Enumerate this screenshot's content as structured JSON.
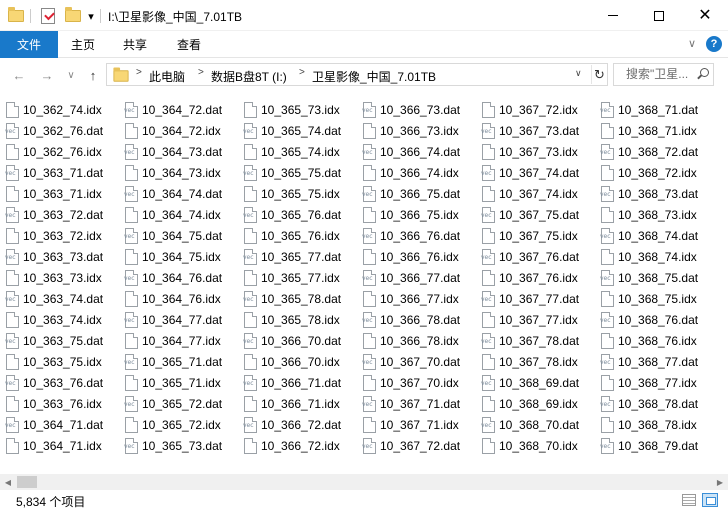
{
  "window": {
    "title": "I:\\卫星影像_中国_7.01TB",
    "dropdown_glyph": "▾",
    "min_label": "",
    "max_label": "",
    "close_label": "✕"
  },
  "ribbon": {
    "file_tab": "文件",
    "tabs": [
      "主页",
      "共享",
      "查看"
    ],
    "expand_glyph": "∨",
    "help_glyph": "?"
  },
  "nav": {
    "back": "←",
    "forward": "→",
    "recent": "∨",
    "up": "↑",
    "breadcrumb": [
      "此电脑",
      "数据B盘8T (I:)",
      "卫星影像_中国_7.01TB"
    ],
    "separator": ">",
    "address_dropdown": "∨",
    "refresh": "↻"
  },
  "search": {
    "placeholder": "搜索\"卫星..."
  },
  "files": {
    "columns": [
      [
        {
          "name": "10_362_74.idx",
          "type": "idx"
        },
        {
          "name": "10_362_76.dat",
          "type": "dat"
        },
        {
          "name": "10_362_76.idx",
          "type": "idx"
        },
        {
          "name": "10_363_71.dat",
          "type": "dat"
        },
        {
          "name": "10_363_71.idx",
          "type": "idx"
        },
        {
          "name": "10_363_72.dat",
          "type": "dat"
        },
        {
          "name": "10_363_72.idx",
          "type": "idx"
        },
        {
          "name": "10_363_73.dat",
          "type": "dat"
        },
        {
          "name": "10_363_73.idx",
          "type": "idx"
        },
        {
          "name": "10_363_74.dat",
          "type": "dat"
        },
        {
          "name": "10_363_74.idx",
          "type": "idx"
        },
        {
          "name": "10_363_75.dat",
          "type": "dat"
        },
        {
          "name": "10_363_75.idx",
          "type": "idx"
        },
        {
          "name": "10_363_76.dat",
          "type": "dat"
        },
        {
          "name": "10_363_76.idx",
          "type": "idx"
        },
        {
          "name": "10_364_71.dat",
          "type": "dat"
        },
        {
          "name": "10_364_71.idx",
          "type": "idx"
        }
      ],
      [
        {
          "name": "10_364_72.dat",
          "type": "dat"
        },
        {
          "name": "10_364_72.idx",
          "type": "idx"
        },
        {
          "name": "10_364_73.dat",
          "type": "dat"
        },
        {
          "name": "10_364_73.idx",
          "type": "idx"
        },
        {
          "name": "10_364_74.dat",
          "type": "dat"
        },
        {
          "name": "10_364_74.idx",
          "type": "idx"
        },
        {
          "name": "10_364_75.dat",
          "type": "dat"
        },
        {
          "name": "10_364_75.idx",
          "type": "idx"
        },
        {
          "name": "10_364_76.dat",
          "type": "dat"
        },
        {
          "name": "10_364_76.idx",
          "type": "idx"
        },
        {
          "name": "10_364_77.dat",
          "type": "dat"
        },
        {
          "name": "10_364_77.idx",
          "type": "idx"
        },
        {
          "name": "10_365_71.dat",
          "type": "dat"
        },
        {
          "name": "10_365_71.idx",
          "type": "idx"
        },
        {
          "name": "10_365_72.dat",
          "type": "dat"
        },
        {
          "name": "10_365_72.idx",
          "type": "idx"
        },
        {
          "name": "10_365_73.dat",
          "type": "dat"
        }
      ],
      [
        {
          "name": "10_365_73.idx",
          "type": "idx"
        },
        {
          "name": "10_365_74.dat",
          "type": "dat"
        },
        {
          "name": "10_365_74.idx",
          "type": "idx"
        },
        {
          "name": "10_365_75.dat",
          "type": "dat"
        },
        {
          "name": "10_365_75.idx",
          "type": "idx"
        },
        {
          "name": "10_365_76.dat",
          "type": "dat"
        },
        {
          "name": "10_365_76.idx",
          "type": "idx"
        },
        {
          "name": "10_365_77.dat",
          "type": "dat"
        },
        {
          "name": "10_365_77.idx",
          "type": "idx"
        },
        {
          "name": "10_365_78.dat",
          "type": "dat"
        },
        {
          "name": "10_365_78.idx",
          "type": "idx"
        },
        {
          "name": "10_366_70.dat",
          "type": "dat"
        },
        {
          "name": "10_366_70.idx",
          "type": "idx"
        },
        {
          "name": "10_366_71.dat",
          "type": "dat"
        },
        {
          "name": "10_366_71.idx",
          "type": "idx"
        },
        {
          "name": "10_366_72.dat",
          "type": "dat"
        },
        {
          "name": "10_366_72.idx",
          "type": "idx"
        }
      ],
      [
        {
          "name": "10_366_73.dat",
          "type": "dat"
        },
        {
          "name": "10_366_73.idx",
          "type": "idx"
        },
        {
          "name": "10_366_74.dat",
          "type": "dat"
        },
        {
          "name": "10_366_74.idx",
          "type": "idx"
        },
        {
          "name": "10_366_75.dat",
          "type": "dat"
        },
        {
          "name": "10_366_75.idx",
          "type": "idx"
        },
        {
          "name": "10_366_76.dat",
          "type": "dat"
        },
        {
          "name": "10_366_76.idx",
          "type": "idx"
        },
        {
          "name": "10_366_77.dat",
          "type": "dat"
        },
        {
          "name": "10_366_77.idx",
          "type": "idx"
        },
        {
          "name": "10_366_78.dat",
          "type": "dat"
        },
        {
          "name": "10_366_78.idx",
          "type": "idx"
        },
        {
          "name": "10_367_70.dat",
          "type": "dat"
        },
        {
          "name": "10_367_70.idx",
          "type": "idx"
        },
        {
          "name": "10_367_71.dat",
          "type": "dat"
        },
        {
          "name": "10_367_71.idx",
          "type": "idx"
        },
        {
          "name": "10_367_72.dat",
          "type": "dat"
        }
      ],
      [
        {
          "name": "10_367_72.idx",
          "type": "idx"
        },
        {
          "name": "10_367_73.dat",
          "type": "dat"
        },
        {
          "name": "10_367_73.idx",
          "type": "idx"
        },
        {
          "name": "10_367_74.dat",
          "type": "dat"
        },
        {
          "name": "10_367_74.idx",
          "type": "idx"
        },
        {
          "name": "10_367_75.dat",
          "type": "dat"
        },
        {
          "name": "10_367_75.idx",
          "type": "idx"
        },
        {
          "name": "10_367_76.dat",
          "type": "dat"
        },
        {
          "name": "10_367_76.idx",
          "type": "idx"
        },
        {
          "name": "10_367_77.dat",
          "type": "dat"
        },
        {
          "name": "10_367_77.idx",
          "type": "idx"
        },
        {
          "name": "10_367_78.dat",
          "type": "dat"
        },
        {
          "name": "10_367_78.idx",
          "type": "idx"
        },
        {
          "name": "10_368_69.dat",
          "type": "dat"
        },
        {
          "name": "10_368_69.idx",
          "type": "idx"
        },
        {
          "name": "10_368_70.dat",
          "type": "dat"
        },
        {
          "name": "10_368_70.idx",
          "type": "idx"
        }
      ],
      [
        {
          "name": "10_368_71.dat",
          "type": "dat"
        },
        {
          "name": "10_368_71.idx",
          "type": "idx"
        },
        {
          "name": "10_368_72.dat",
          "type": "dat"
        },
        {
          "name": "10_368_72.idx",
          "type": "idx"
        },
        {
          "name": "10_368_73.dat",
          "type": "dat"
        },
        {
          "name": "10_368_73.idx",
          "type": "idx"
        },
        {
          "name": "10_368_74.dat",
          "type": "dat"
        },
        {
          "name": "10_368_74.idx",
          "type": "idx"
        },
        {
          "name": "10_368_75.dat",
          "type": "dat"
        },
        {
          "name": "10_368_75.idx",
          "type": "idx"
        },
        {
          "name": "10_368_76.dat",
          "type": "dat"
        },
        {
          "name": "10_368_76.idx",
          "type": "idx"
        },
        {
          "name": "10_368_77.dat",
          "type": "dat"
        },
        {
          "name": "10_368_77.idx",
          "type": "idx"
        },
        {
          "name": "10_368_78.dat",
          "type": "dat"
        },
        {
          "name": "10_368_78.idx",
          "type": "idx"
        },
        {
          "name": "10_368_79.dat",
          "type": "dat"
        }
      ]
    ]
  },
  "scrollbar": {
    "left_arrow": "◀",
    "right_arrow": "▶"
  },
  "status": {
    "item_count": "5,834 个项目"
  },
  "colors": {
    "accent": "#1979ca",
    "folder": "#f8d775"
  }
}
